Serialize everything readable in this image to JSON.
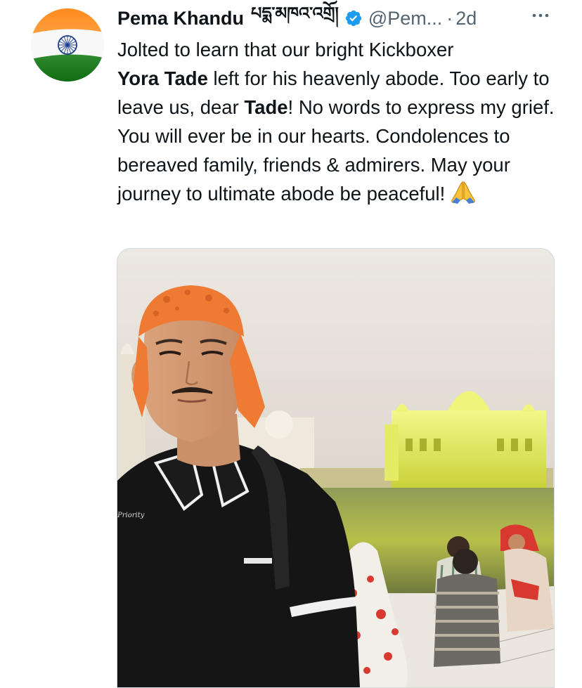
{
  "author": {
    "display_name": "Pema Khandu",
    "native_name": "པདྨ་མཁའ་འགྲོ།",
    "handle": "@Pem...",
    "separator": "·",
    "time": "2d"
  },
  "tweet": {
    "line1": "Jolted to learn that our bright Kickboxer",
    "bold_name": "Yora Tade",
    "line2_rest": " left for his heavenly abode. Too early to leave us, dear ",
    "bold_short": "Tade",
    "rest": "! No words to express my grief. You will ever be in our hearts. Condolences to bereaved family, friends & admirers. May your journey to ultimate abode be peaceful!"
  },
  "media": {
    "shirt_text": "Priority"
  },
  "icons": {
    "verified": "verified-badge-icon",
    "more": "more-options-icon",
    "pray": "folded-hands-emoji",
    "avatar": "india-flag-avatar"
  },
  "colors": {
    "verified_blue": "#1d9bf0",
    "secondary_text": "#536471",
    "saffron": "#ff9933",
    "green": "#138808"
  }
}
